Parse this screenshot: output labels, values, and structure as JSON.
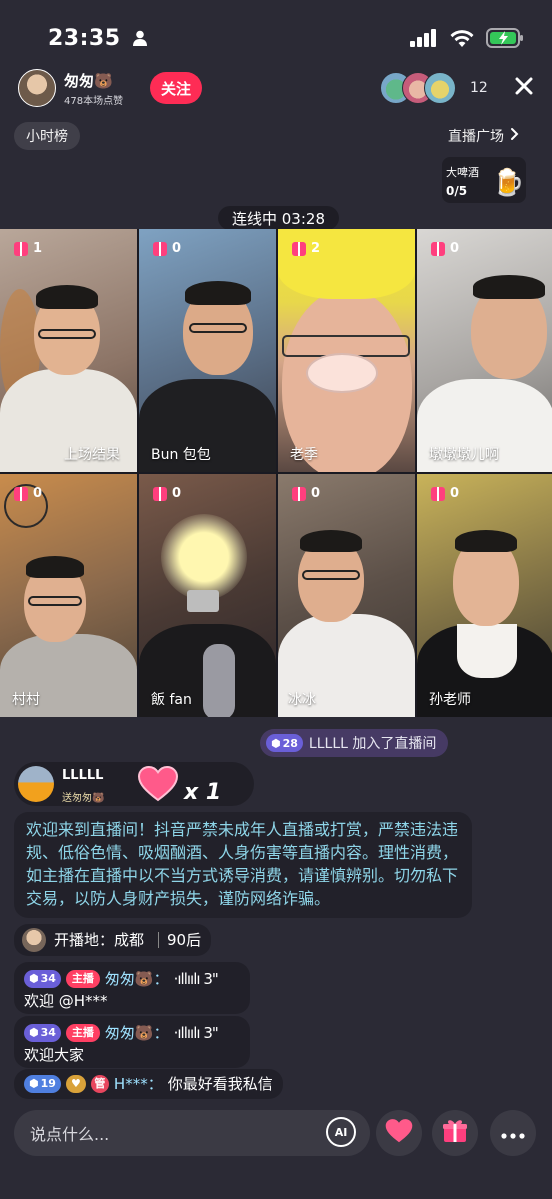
{
  "status": {
    "time": "23:35"
  },
  "host": {
    "name": "匆匆🐻",
    "likes": "478本场点赞",
    "follow_label": "关注"
  },
  "viewers": {
    "count": "12"
  },
  "top": {
    "hour_rank": "小时榜",
    "live_square": "直播广场",
    "beer_name": "大啤酒",
    "beer_progress": "0/5"
  },
  "link": {
    "timer": "连线中 03:28"
  },
  "grid": {
    "cells": [
      {
        "label": "上场结果",
        "gifts": "1"
      },
      {
        "label": "Bun 包包",
        "gifts": "0"
      },
      {
        "label": "老季",
        "gifts": "2"
      },
      {
        "label": "墩墩墩儿啊",
        "gifts": "0"
      },
      {
        "label": "村村",
        "gifts": "0"
      },
      {
        "label": "飯 fan",
        "gifts": "0"
      },
      {
        "label": "冰冰",
        "gifts": "0"
      },
      {
        "label": "孙老师",
        "gifts": "0"
      }
    ]
  },
  "join": {
    "level": "28",
    "text": "LLLLL 加入了直播间"
  },
  "gift": {
    "user": "LLLLL",
    "sent": "送匆匆🐻",
    "count": "x 1"
  },
  "notice": {
    "text": "欢迎来到直播间！抖音严禁未成年人直播或打赏，严禁违法违规、低俗色情、吸烟酗酒、人身伤害等直播内容。理性消费，如主播在直播中以不当方式诱导消费，请谨慎辨别。切勿私下交易，以防人身财产损失，谨防网络诈骗。"
  },
  "chat": {
    "city_label": "开播地：成都",
    "age_label": "90后",
    "messages": [
      {
        "level": "34",
        "tag": "主播",
        "name": "匆匆🐻：",
        "voice": "·ıllıılı 3\"",
        "text": "欢迎 @H***"
      },
      {
        "level": "34",
        "tag": "主播",
        "name": "匆匆🐻：",
        "voice": "·ıllıılı 3\"",
        "text": "欢迎大家"
      }
    ],
    "last": {
      "level": "19",
      "badge": "管",
      "name": "H***：",
      "text": "你最好看我私信"
    }
  },
  "bottom": {
    "placeholder": "说点什么...",
    "ai_label": "AI"
  },
  "colors": {
    "accent": "#fe2c55",
    "background": "#2b2a35",
    "notice_text": "#8ed5e8"
  }
}
